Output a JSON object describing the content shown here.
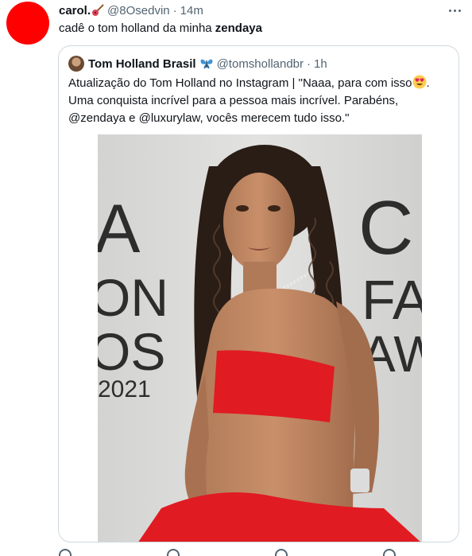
{
  "tweet": {
    "author_name": "carol.",
    "author_handle": "@8Osedvin",
    "separator": "·",
    "time": "14m",
    "text_prefix": "cadê o tom holland da minha ",
    "text_bold": "zendaya"
  },
  "quoted_tweet": {
    "author_name": "Tom Holland Brasil",
    "author_handle": "@tomshollandbr",
    "separator": "·",
    "time": "1h",
    "text_part1": "Atualização do Tom Holland no Instagram | \"Naaa, para com isso",
    "text_part2": ". Uma conquista incrível para a pessoa mais incrível. Parabéns, @zendaya e @luxurylaw, vocês merecem tudo isso.\"",
    "photo_backdrop": {
      "left_letters": [
        "A",
        "ON",
        "OS",
        "2021"
      ],
      "right_letters": [
        "C",
        "FA",
        "AW"
      ]
    }
  },
  "icons": [
    "guitar-emoji-icon",
    "more-options-icon",
    "butterfly-emoji-icon",
    "heart-eyes-emoji-icon"
  ]
}
